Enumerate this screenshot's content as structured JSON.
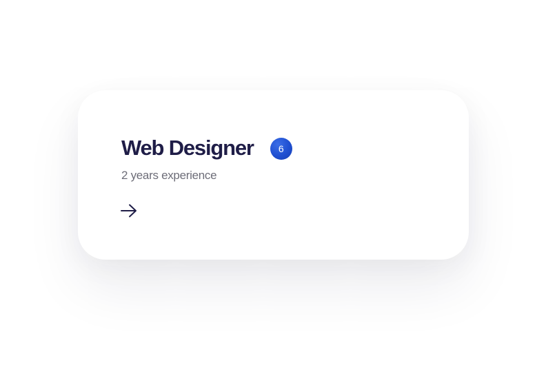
{
  "card": {
    "title": "Web Designer",
    "badge_count": "6",
    "subtitle": "2 years experience",
    "arrow_icon": "arrow-right-icon"
  },
  "colors": {
    "title": "#1f1d47",
    "badge": "#1f4fd1",
    "subtitle": "#6d6d78"
  }
}
